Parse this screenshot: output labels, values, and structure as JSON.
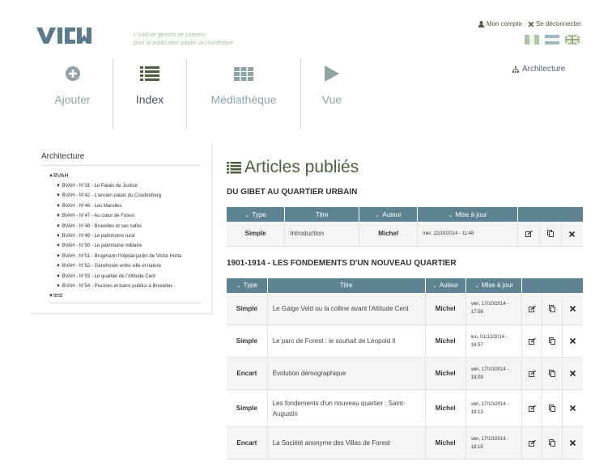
{
  "header": {
    "logo_text": "VIEW",
    "tagline_line1": "L'outil de gestion de contenu",
    "tagline_line2": "pour la publication papier ou numérique",
    "account_label": "Mon compte",
    "logout_label": "Se déconnecter"
  },
  "nav": {
    "add": "Ajouter",
    "index": "Index",
    "media": "Médiathèque",
    "view": "Vue"
  },
  "breadcrumb": "Architecture",
  "sidebar": {
    "title": "Architecture",
    "root": "BVAH",
    "items": [
      "BVAH - N°31 - Le Palais de Justice",
      "BVAH - N°42 - L'ancien palais du Coudenberg",
      "BVAH - N°46 - Les Marolles",
      "BVAH - N°47 - Au cœur de Forest",
      "BVAH - N°48 - Bruxelles et ses cafés",
      "BVAH - N°49 - Le patrimoine rural",
      "BVAH - N°50 - Le patrimoine militaire",
      "BVAH - N°51 - Brugmann l'hôpital-jardin de Victor Horta",
      "BVAH - N°52 - Ganshoren entre ville et nature",
      "BVAH - N°53 - Le quartier de l'Altitude Cent",
      "BVAH - N°54 - Piscines et bains publics à Bruxelles"
    ],
    "second_root": "test"
  },
  "main": {
    "title": "Articles publiés",
    "columns": {
      "type": "Type",
      "title": "Titre",
      "author": "Auteur",
      "updated": "Mise à jour"
    },
    "section1": {
      "title": "DU GIBET AU QUARTIER URBAIN",
      "rows": [
        {
          "type": "Simple",
          "title": "Introduction",
          "author": "Michel",
          "date": "mer, 22/10/2014 - 11:48"
        }
      ]
    },
    "section2": {
      "title": "1901-1914 - LES FONDEMENTS D'UN NOUVEAU QUARTIER",
      "rows": [
        {
          "type": "Simple",
          "title": "Le Galge Veld ou la colline avant l'Altitude Cent",
          "author": "Michel",
          "date1": "ven, 17/10/2014 -",
          "date2": "17:58"
        },
        {
          "type": "Simple",
          "title": "Le parc de Forest : le souhait de Léopold II",
          "author": "Michel",
          "date1": "lun, 01/12/2014 -",
          "date2": "16:57"
        },
        {
          "type": "Encart",
          "title": "Évolution démographique",
          "author": "Michel",
          "date1": "ven, 17/10/2014 -",
          "date2": "18:09"
        },
        {
          "type": "Simple",
          "title": "Les fondements d'un nouveau quartier : Saint-Augustin",
          "author": "Michel",
          "date1": "ven, 17/10/2014 -",
          "date2": "18:13"
        },
        {
          "type": "Encart",
          "title": "La Société anonyme des Villas de Forest",
          "author": "Michel",
          "date1": "ven, 17/10/2014 -",
          "date2": "18:15"
        }
      ]
    }
  },
  "colors": {
    "accent_olive": "#4e5f3e",
    "table_header": "#5d8291",
    "nav_text": "#8ea4a5",
    "logo": "#5d7a8a"
  }
}
